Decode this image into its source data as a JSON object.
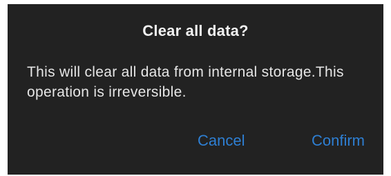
{
  "dialog": {
    "title": "Clear all data?",
    "message": "This will clear all data from internal storage.This operation is irreversible.",
    "cancel_label": "Cancel",
    "confirm_label": "Confirm"
  },
  "colors": {
    "background": "#222222",
    "text": "#f2f2f2",
    "accent": "#2e7fd3"
  }
}
